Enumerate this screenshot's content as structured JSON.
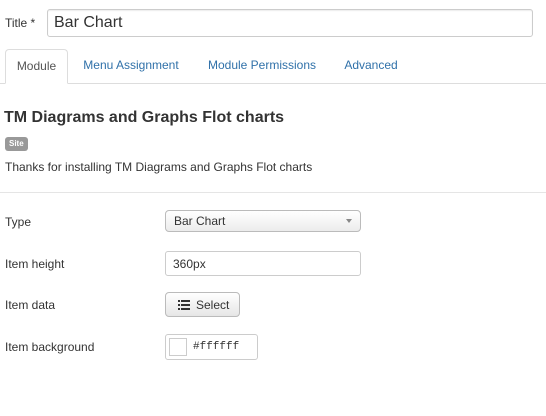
{
  "title_field": {
    "label": "Title *",
    "value": "Bar Chart"
  },
  "tabs": [
    {
      "label": "Module",
      "active": true
    },
    {
      "label": "Menu Assignment",
      "active": false
    },
    {
      "label": "Module Permissions",
      "active": false
    },
    {
      "label": "Advanced",
      "active": false
    }
  ],
  "module": {
    "heading": "TM Diagrams and Graphs Flot charts",
    "badge": "Site",
    "description": "Thanks for installing TM Diagrams and Graphs Flot charts"
  },
  "form": {
    "type": {
      "label": "Type",
      "value": "Bar Chart"
    },
    "item_height": {
      "label": "Item height",
      "value": "360px"
    },
    "item_data": {
      "label": "Item data",
      "button_label": "Select"
    },
    "item_background": {
      "label": "Item background",
      "value": "#ffffff",
      "swatch_color": "#ffffff"
    }
  },
  "icons": {
    "select_button_icon": "list-icon",
    "dropdown_icon": "chevron-down-icon"
  },
  "colors": {
    "link": "#3071a9",
    "badge": "#999999"
  }
}
